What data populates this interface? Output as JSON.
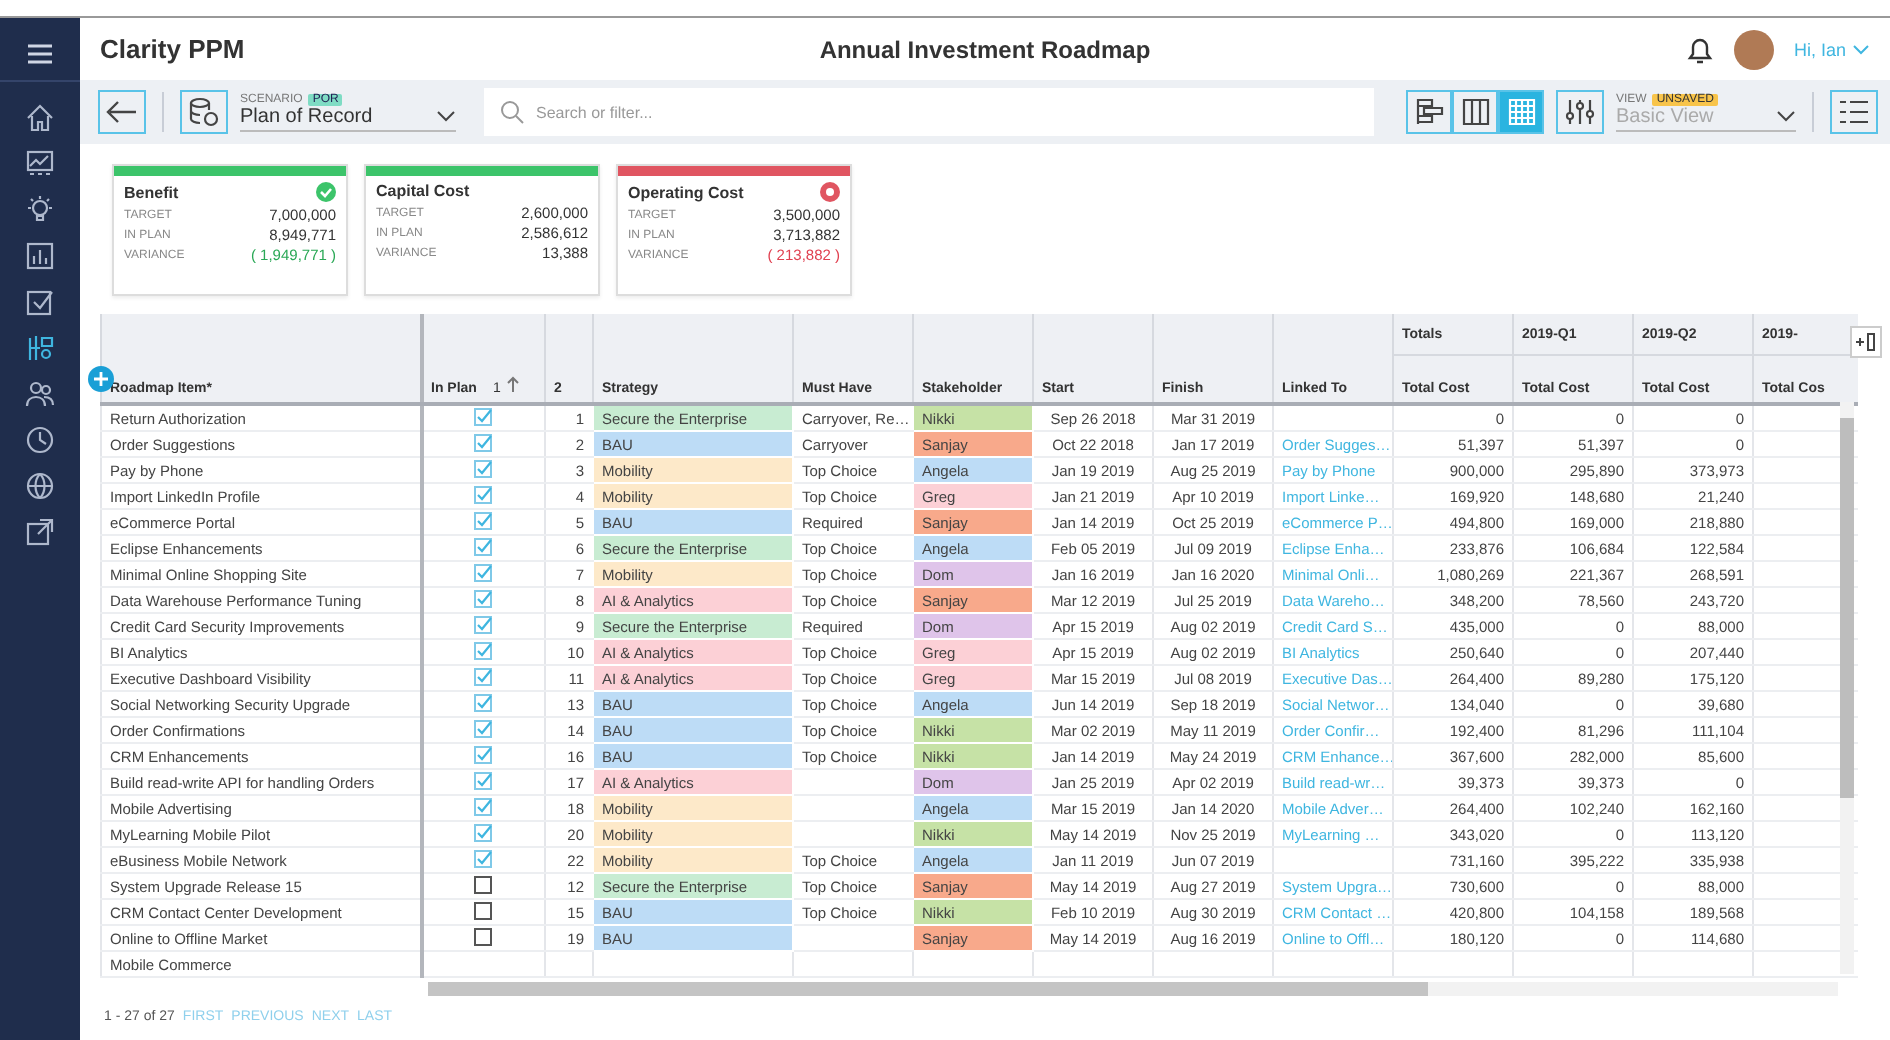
{
  "app": {
    "name": "Clarity PPM",
    "page_title": "Annual Investment Roadmap",
    "user_greeting": "Hi, Ian"
  },
  "sidebar": {
    "items": [
      {
        "selected": false
      },
      {
        "selected": false
      },
      {
        "selected": false
      },
      {
        "selected": false
      },
      {
        "selected": false
      },
      {
        "selected": true
      },
      {
        "selected": false
      },
      {
        "selected": false
      },
      {
        "selected": false
      },
      {
        "selected": false
      }
    ]
  },
  "toolbar": {
    "scenario_label": "SCENARIO",
    "scenario_badge": "POR",
    "scenario_value": "Plan of Record",
    "search_placeholder": "Search or filter...",
    "view_modes": [
      {
        "selected": false
      },
      {
        "selected": false
      },
      {
        "selected": true
      }
    ],
    "view_label": "VIEW",
    "view_badge": "UNSAVED",
    "view_value": "Basic View"
  },
  "cards": [
    {
      "title": "Benefit",
      "color": "#3cc46a",
      "met": true,
      "exceeded": false,
      "rows": [
        {
          "label": "TARGET",
          "value": "7,000,000"
        },
        {
          "label": "IN PLAN",
          "value": "8,949,771"
        },
        {
          "label": "VARIANCE",
          "value": "( 1,949,771 )"
        }
      ]
    },
    {
      "title": "Capital Cost",
      "color": "#3cc46a",
      "met": false,
      "exceeded": false,
      "rows": [
        {
          "label": "TARGET",
          "value": "2,600,000"
        },
        {
          "label": "IN PLAN",
          "value": "2,586,612"
        },
        {
          "label": "VARIANCE",
          "value": "13,388"
        }
      ]
    },
    {
      "title": "Operating Cost",
      "color": "#e05561",
      "met": false,
      "exceeded": true,
      "rows": [
        {
          "label": "TARGET",
          "value": "3,500,000"
        },
        {
          "label": "IN PLAN",
          "value": "3,713,882"
        },
        {
          "label": "VARIANCE",
          "value": "( 213,882 )"
        }
      ]
    }
  ],
  "table": {
    "group_headers": [
      "Totals",
      "2019-Q1",
      "2019-Q2",
      "2019-"
    ],
    "columns": [
      {
        "label": "Roadmap Item*"
      },
      {
        "label": "In Plan",
        "sort_order": "1",
        "sort_ascending": true
      },
      {
        "label": "2"
      },
      {
        "label": "Strategy"
      },
      {
        "label": "Must Have"
      },
      {
        "label": "Stakeholder"
      },
      {
        "label": "Start"
      },
      {
        "label": "Finish"
      },
      {
        "label": "Linked To"
      },
      {
        "label": "Total Cost"
      },
      {
        "label": "Total Cost"
      },
      {
        "label": "Total Cost"
      },
      {
        "label": "Total Cos"
      }
    ],
    "rows": [
      {
        "item": "Return Authorization",
        "in_plan": true,
        "rank": "1",
        "strategy": {
          "label": "Secure the Enterprise",
          "color": "#c8ecd2"
        },
        "must_have": "Carryover, Re…",
        "stakeholder": {
          "name": "Nikki",
          "color": "#c6e2a6"
        },
        "start": "Sep 26 2018",
        "finish": "Mar 31 2019",
        "costs": [
          "0",
          "0",
          "0"
        ]
      },
      {
        "item": "Order Suggestions",
        "in_plan": true,
        "rank": "2",
        "strategy": {
          "label": "BAU",
          "color": "#bddcf6"
        },
        "must_have": "Carryover",
        "stakeholder": {
          "name": "Sanjay",
          "color": "#f8a98b"
        },
        "start": "Oct 22 2018",
        "finish": "Jan 17 2019",
        "linked_to": "Order Sugges…",
        "costs": [
          "51,397",
          "51,397",
          "0"
        ]
      },
      {
        "item": "Pay by Phone",
        "in_plan": true,
        "rank": "3",
        "strategy": {
          "label": "Mobility",
          "color": "#fde9c9"
        },
        "must_have": "Top Choice",
        "stakeholder": {
          "name": "Angela",
          "color": "#bddcf6"
        },
        "start": "Jan 19 2019",
        "finish": "Aug 25 2019",
        "linked_to": "Pay by Phone",
        "costs": [
          "900,000",
          "295,890",
          "373,973"
        ]
      },
      {
        "item": "Import LinkedIn Profile",
        "in_plan": true,
        "rank": "4",
        "strategy": {
          "label": "Mobility",
          "color": "#fde9c9"
        },
        "must_have": "Top Choice",
        "stakeholder": {
          "name": "Greg",
          "color": "#fcd0d6"
        },
        "start": "Jan 21 2019",
        "finish": "Apr 10 2019",
        "linked_to": "Import Linke…",
        "costs": [
          "169,920",
          "148,680",
          "21,240"
        ]
      },
      {
        "item": "eCommerce Portal",
        "in_plan": true,
        "rank": "5",
        "strategy": {
          "label": "BAU",
          "color": "#bddcf6"
        },
        "must_have": "Required",
        "stakeholder": {
          "name": "Sanjay",
          "color": "#f8a98b"
        },
        "start": "Jan 14 2019",
        "finish": "Oct 25 2019",
        "linked_to": "eCommerce P…",
        "costs": [
          "494,800",
          "169,000",
          "218,880"
        ]
      },
      {
        "item": "Eclipse Enhancements",
        "in_plan": true,
        "rank": "6",
        "strategy": {
          "label": "Secure the Enterprise",
          "color": "#c8ecd2"
        },
        "must_have": "Top Choice",
        "stakeholder": {
          "name": "Angela",
          "color": "#bddcf6"
        },
        "start": "Feb 05 2019",
        "finish": "Jul 09 2019",
        "linked_to": "Eclipse Enha…",
        "costs": [
          "233,876",
          "106,684",
          "122,584"
        ]
      },
      {
        "item": "Minimal Online Shopping Site",
        "in_plan": true,
        "rank": "7",
        "strategy": {
          "label": "Mobility",
          "color": "#fde9c9"
        },
        "must_have": "Top Choice",
        "stakeholder": {
          "name": "Dom",
          "color": "#dfc4ea"
        },
        "start": "Jan 16 2019",
        "finish": "Jan 16 2020",
        "linked_to": "Minimal Onli…",
        "costs": [
          "1,080,269",
          "221,367",
          "268,591"
        ]
      },
      {
        "item": "Data Warehouse Performance Tuning",
        "in_plan": true,
        "rank": "8",
        "strategy": {
          "label": "AI & Analytics",
          "color": "#fcd0d6"
        },
        "must_have": "Top Choice",
        "stakeholder": {
          "name": "Sanjay",
          "color": "#f8a98b"
        },
        "start": "Mar 12 2019",
        "finish": "Jul 25 2019",
        "linked_to": "Data Wareho…",
        "costs": [
          "348,200",
          "78,560",
          "243,720"
        ]
      },
      {
        "item": "Credit Card Security Improvements",
        "in_plan": true,
        "rank": "9",
        "strategy": {
          "label": "Secure the Enterprise",
          "color": "#c8ecd2"
        },
        "must_have": "Required",
        "stakeholder": {
          "name": "Dom",
          "color": "#dfc4ea"
        },
        "start": "Apr 15 2019",
        "finish": "Aug 02 2019",
        "linked_to": "Credit Card S…",
        "costs": [
          "435,000",
          "0",
          "88,000"
        ]
      },
      {
        "item": "BI Analytics",
        "in_plan": true,
        "rank": "10",
        "strategy": {
          "label": "AI & Analytics",
          "color": "#fcd0d6"
        },
        "must_have": "Top Choice",
        "stakeholder": {
          "name": "Greg",
          "color": "#fcd0d6"
        },
        "start": "Apr 15 2019",
        "finish": "Aug 02 2019",
        "linked_to": "BI Analytics",
        "costs": [
          "250,640",
          "0",
          "207,440"
        ]
      },
      {
        "item": "Executive Dashboard Visibility",
        "in_plan": true,
        "rank": "11",
        "strategy": {
          "label": "AI & Analytics",
          "color": "#fcd0d6"
        },
        "must_have": "Top Choice",
        "stakeholder": {
          "name": "Greg",
          "color": "#fcd0d6"
        },
        "start": "Mar 15 2019",
        "finish": "Jul 08 2019",
        "linked_to": "Executive Das…",
        "costs": [
          "264,400",
          "89,280",
          "175,120"
        ]
      },
      {
        "item": "Social Networking Security Upgrade",
        "in_plan": true,
        "rank": "13",
        "strategy": {
          "label": "BAU",
          "color": "#bddcf6"
        },
        "must_have": "Top Choice",
        "stakeholder": {
          "name": "Angela",
          "color": "#bddcf6"
        },
        "start": "Jun 14 2019",
        "finish": "Sep 18 2019",
        "linked_to": "Social Networ…",
        "costs": [
          "134,040",
          "0",
          "39,680"
        ]
      },
      {
        "item": "Order Confirmations",
        "in_plan": true,
        "rank": "14",
        "strategy": {
          "label": "BAU",
          "color": "#bddcf6"
        },
        "must_have": "Top Choice",
        "stakeholder": {
          "name": "Nikki",
          "color": "#c6e2a6"
        },
        "start": "Mar 02 2019",
        "finish": "May 11 2019",
        "linked_to": "Order Confir…",
        "costs": [
          "192,400",
          "81,296",
          "111,104"
        ]
      },
      {
        "item": "CRM Enhancements",
        "in_plan": true,
        "rank": "16",
        "strategy": {
          "label": "BAU",
          "color": "#bddcf6"
        },
        "must_have": "Top Choice",
        "stakeholder": {
          "name": "Nikki",
          "color": "#c6e2a6"
        },
        "start": "Jan 14 2019",
        "finish": "May 24 2019",
        "linked_to": "CRM Enhance…",
        "costs": [
          "367,600",
          "282,000",
          "85,600"
        ]
      },
      {
        "item": "Build read-write API for handling Orders",
        "in_plan": true,
        "rank": "17",
        "strategy": {
          "label": "AI & Analytics",
          "color": "#fcd0d6"
        },
        "stakeholder": {
          "name": "Dom",
          "color": "#dfc4ea"
        },
        "start": "Jan 25 2019",
        "finish": "Apr 02 2019",
        "linked_to": "Build read-wr…",
        "costs": [
          "39,373",
          "39,373",
          "0"
        ]
      },
      {
        "item": "Mobile Advertising",
        "in_plan": true,
        "rank": "18",
        "strategy": {
          "label": "Mobility",
          "color": "#fde9c9"
        },
        "stakeholder": {
          "name": "Angela",
          "color": "#bddcf6"
        },
        "start": "Mar 15 2019",
        "finish": "Jan 14 2020",
        "linked_to": "Mobile Adver…",
        "costs": [
          "264,400",
          "102,240",
          "162,160"
        ]
      },
      {
        "item": "MyLearning Mobile Pilot",
        "in_plan": true,
        "rank": "20",
        "strategy": {
          "label": "Mobility",
          "color": "#fde9c9"
        },
        "stakeholder": {
          "name": "Nikki",
          "color": "#c6e2a6"
        },
        "start": "May 14 2019",
        "finish": "Nov 25 2019",
        "linked_to": "MyLearning …",
        "costs": [
          "343,020",
          "0",
          "113,120"
        ]
      },
      {
        "item": "eBusiness Mobile Network",
        "in_plan": true,
        "rank": "22",
        "strategy": {
          "label": "Mobility",
          "color": "#fde9c9"
        },
        "must_have": "Top Choice",
        "stakeholder": {
          "name": "Angela",
          "color": "#bddcf6"
        },
        "start": "Jan 11 2019",
        "finish": "Jun 07 2019",
        "costs": [
          "731,160",
          "395,222",
          "335,938"
        ]
      },
      {
        "item": "System Upgrade Release 15",
        "in_plan": false,
        "rank": "12",
        "strategy": {
          "label": "Secure the Enterprise",
          "color": "#c8ecd2"
        },
        "must_have": "Top Choice",
        "stakeholder": {
          "name": "Sanjay",
          "color": "#f8a98b"
        },
        "start": "May 14 2019",
        "finish": "Aug 27 2019",
        "linked_to": "System Upgra…",
        "costs": [
          "730,600",
          "0",
          "88,000"
        ]
      },
      {
        "item": "CRM Contact Center Development",
        "in_plan": false,
        "rank": "15",
        "strategy": {
          "label": "BAU",
          "color": "#bddcf6"
        },
        "must_have": "Top Choice",
        "stakeholder": {
          "name": "Nikki",
          "color": "#c6e2a6"
        },
        "start": "Feb 10 2019",
        "finish": "Aug 30 2019",
        "linked_to": "CRM Contact …",
        "costs": [
          "420,800",
          "104,158",
          "189,568"
        ]
      },
      {
        "item": "Online to Offline Market",
        "in_plan": false,
        "rank": "19",
        "strategy": {
          "label": "BAU",
          "color": "#bddcf6"
        },
        "stakeholder": {
          "name": "Sanjay",
          "color": "#f8a98b"
        },
        "start": "May 14 2019",
        "finish": "Aug 16 2019",
        "linked_to": "Online to Offl…",
        "costs": [
          "180,120",
          "0",
          "114,680"
        ]
      },
      {
        "item": "Mobile Commerce"
      }
    ]
  },
  "pagination": {
    "range": "1 - 27 of 27",
    "links": [
      "FIRST",
      "PREVIOUS",
      "NEXT",
      "LAST"
    ]
  }
}
